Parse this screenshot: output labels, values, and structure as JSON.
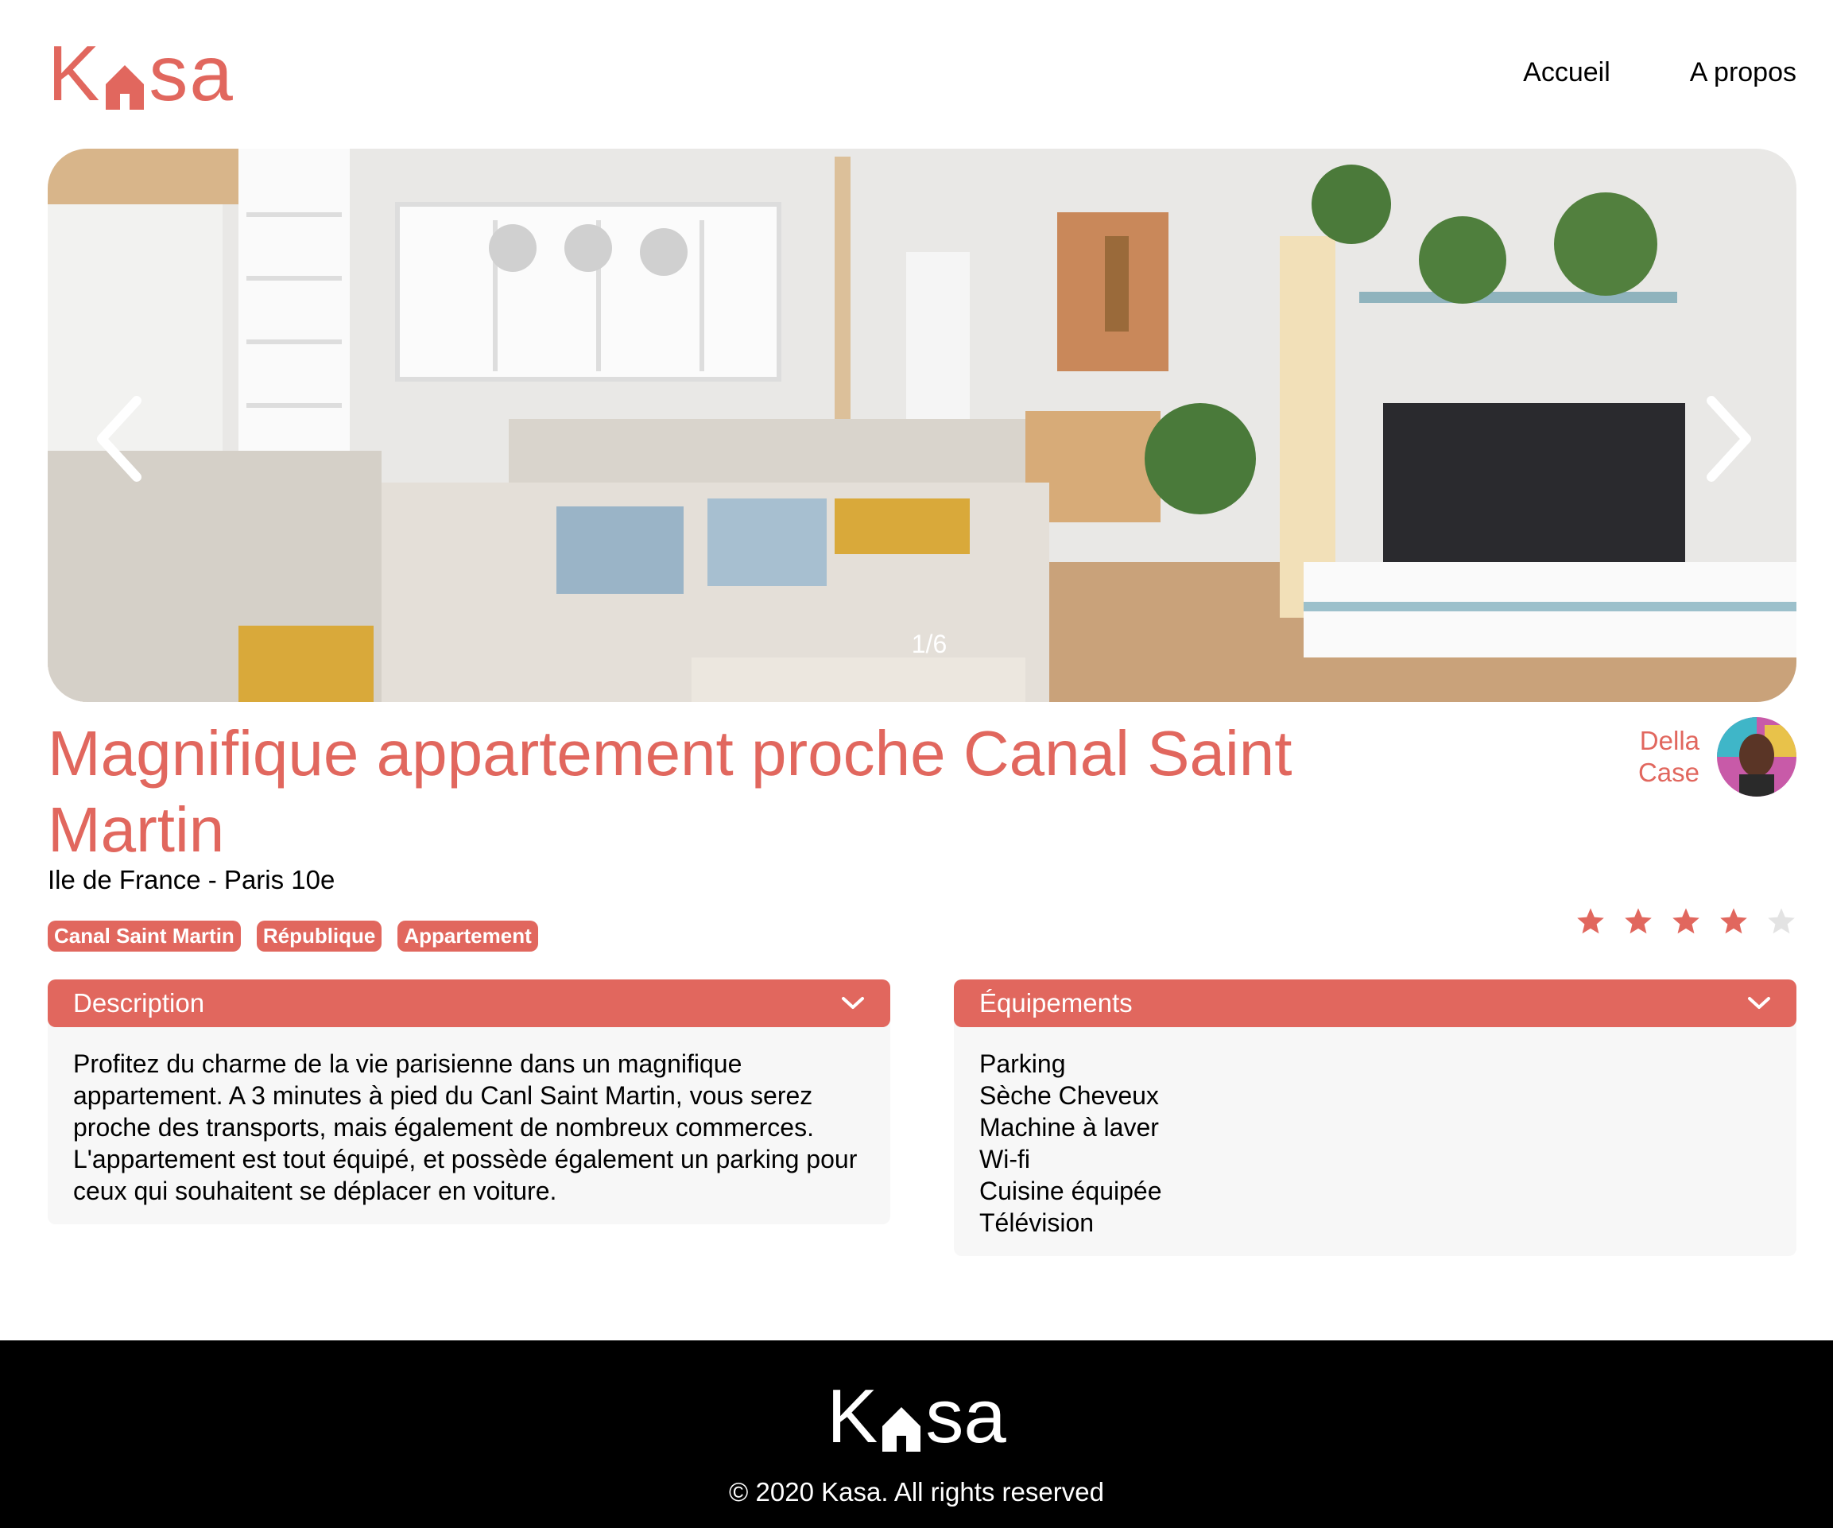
{
  "brand": {
    "letters_before": "K",
    "letters_after": "sa",
    "color": "#E1675E"
  },
  "nav": {
    "home": "Accueil",
    "about": "A propos"
  },
  "gallery": {
    "counter": "1/6"
  },
  "listing": {
    "title": "Magnifique appartement proche Canal Saint Martin",
    "location": "Ile de France - Paris 10e",
    "tags": [
      "Canal Saint Martin",
      "République",
      "Appartement"
    ],
    "host": {
      "first_name": "Della",
      "last_name": "Case"
    },
    "rating": 4,
    "rating_max": 5
  },
  "description": {
    "title": "Description",
    "text": "Profitez du charme de la vie parisienne dans un magnifique appartement. A 3 minutes à pied du Canl Saint Martin, vous serez proche des transports, mais également de nombreux commerces. L'appartement est tout équipé, et possède également un parking pour ceux qui souhaitent se déplacer en voiture."
  },
  "equipments": {
    "title": "Équipements",
    "items": [
      "Parking",
      "Sèche Cheveux",
      "Machine à laver",
      "Wi-fi",
      "Cuisine équipée",
      "Télévision"
    ]
  },
  "footer": {
    "copyright": "© 2020 Kasa. All rights reserved"
  },
  "icons": {
    "prev": "chevron-left-icon",
    "next": "chevron-right-icon",
    "toggle": "chevron-down-icon",
    "star": "star-icon",
    "logo": "house-icon"
  },
  "colors": {
    "accent": "#E1675E",
    "star_empty": "#E3E3E3",
    "panel_bg": "#F7F7F7"
  }
}
